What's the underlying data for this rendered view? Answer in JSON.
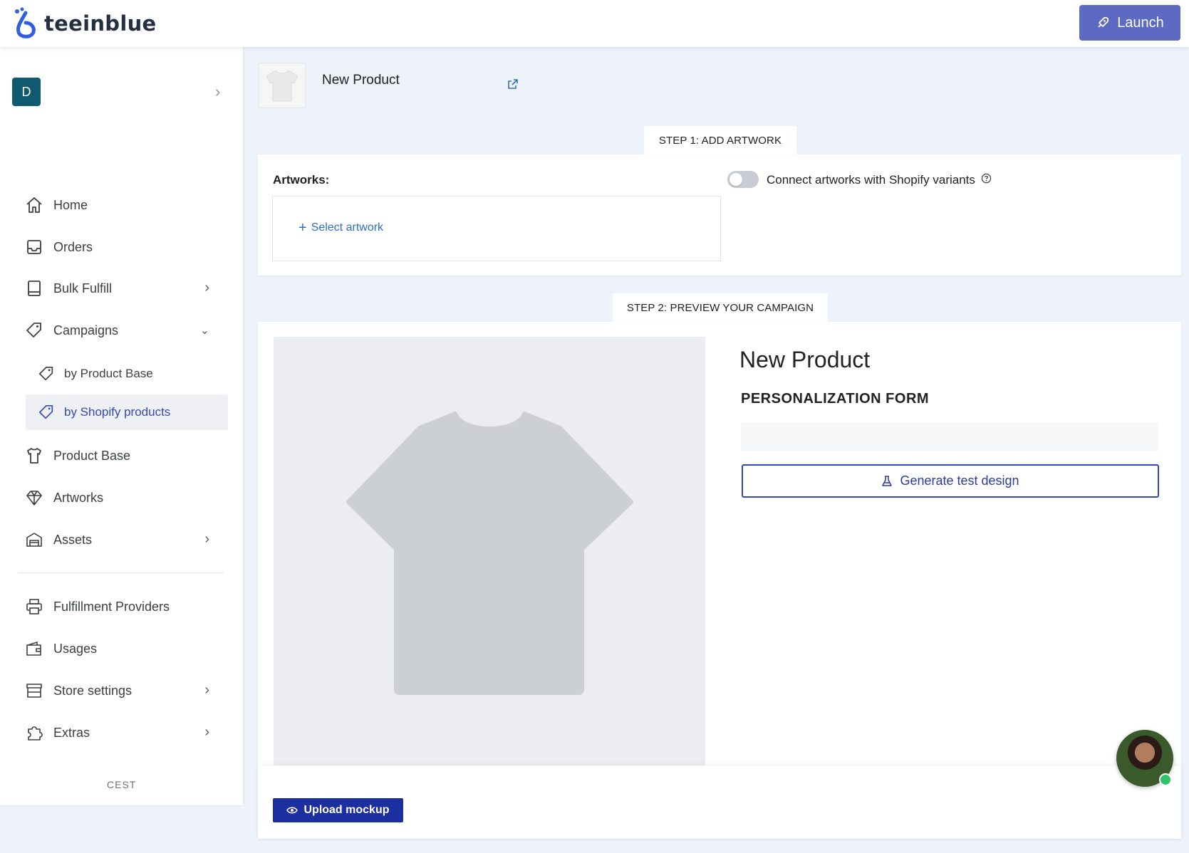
{
  "app": {
    "name": "teeinblue",
    "launch_label": "Launch"
  },
  "sidebar": {
    "store_initial": "D",
    "items": [
      {
        "label": "Home",
        "icon": "home-icon"
      },
      {
        "label": "Orders",
        "icon": "inbox-icon"
      },
      {
        "label": "Bulk Fulfill",
        "icon": "book-icon"
      },
      {
        "label": "Campaigns",
        "icon": "tag-icon"
      },
      {
        "label": "Product Base",
        "icon": "shirt-icon"
      },
      {
        "label": "Artworks",
        "icon": "diamond-icon"
      },
      {
        "label": "Assets",
        "icon": "warehouse-icon"
      },
      {
        "label": "Fulfillment Providers",
        "icon": "printer-icon"
      },
      {
        "label": "Usages",
        "icon": "wallet-icon"
      },
      {
        "label": "Store settings",
        "icon": "store-icon"
      },
      {
        "label": "Extras",
        "icon": "puzzle-icon"
      }
    ],
    "campaign_subitems": [
      {
        "label": "by Product Base"
      },
      {
        "label": "by Shopify products"
      }
    ],
    "footer_text": "CEST"
  },
  "product": {
    "title": "New Product"
  },
  "step1": {
    "tab_label": "STEP 1: ADD ARTWORK",
    "artworks_label": "Artworks:",
    "select_artwork_label": "Select artwork",
    "connect_label": "Connect artworks with Shopify variants"
  },
  "step2": {
    "tab_label": "STEP 2: PREVIEW YOUR CAMPAIGN",
    "product_title": "New Product",
    "form_title": "PERSONALIZATION FORM",
    "generate_label": "Generate test design",
    "upload_label": "Upload mockup"
  },
  "colors": {
    "accent": "#5c6ac4",
    "primary_dark": "#1b2fa0",
    "link": "#2c6ecb",
    "active_nav": "#3548b5"
  }
}
